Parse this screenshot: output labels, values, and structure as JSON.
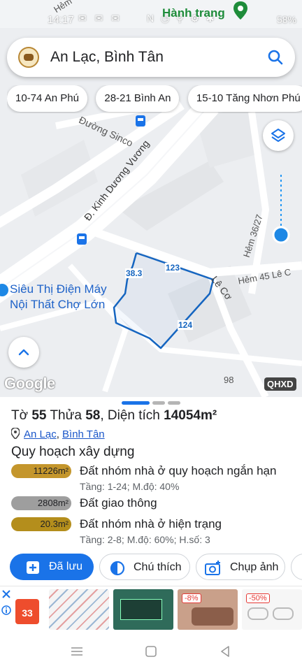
{
  "status_bar": {
    "time": "14:17",
    "left_icons": "✉ ✉ ✉",
    "right_icons": "N ◷ ⚲ ⚙ ✱",
    "network": "4G ᯤ",
    "battery": "58%"
  },
  "map": {
    "overlay_text": "Hành trang",
    "search": {
      "title": "An Lạc, Bình Tân"
    },
    "chips": [
      "10-74 An Phú",
      "28-21 Bình An",
      "15-10 Tăng Nhơn Phú"
    ],
    "labels": {
      "street_sinco": "Đường Sinco",
      "street_kdv": "Đ. Kinh Dương Vương",
      "lane_hem36": "Hẻm 36/27",
      "lane_hem45": "Hẻm 45 Lê C",
      "street_leco": "Lê Cơ",
      "poi_store_line1": "Siêu Thị Điện Máy",
      "poi_store_line2": "Nội Thất Chợ Lớn",
      "parcel_38": "38.3",
      "parcel_123": "123",
      "parcel_124": "124",
      "number_98": "98",
      "hem_top": "Hẻm"
    },
    "google": "Google",
    "qhxd": "QHXD"
  },
  "sheet": {
    "sheet_label": "Tờ",
    "sheet_no": "55",
    "parcel_label": "Thửa",
    "parcel_no": "58",
    "area_label": "Diện tích",
    "area": "14054m²",
    "ward": "An Lạc",
    "district": "Bình Tân",
    "section_title": "Quy hoạch xây dựng",
    "zones": [
      {
        "area": "11226m²",
        "name": "Đất nhóm nhà ở quy hoạch ngắn hạn",
        "detail": "Tầng: 1-24; M.độ: 40%",
        "color": "#c4962c"
      },
      {
        "area": "2808m²",
        "name": "Đất giao thông",
        "detail": "",
        "color": "#9e9e9e"
      },
      {
        "area": "20.3m²",
        "name": "Đất nhóm nhà ở hiện trạng",
        "detail": "Tầng: 2-8; M.độ: 60%; H.số: 3",
        "color": "#b48e1c"
      }
    ],
    "actions": {
      "saved": "Đã lưu",
      "legend": "Chú thích",
      "photo": "Chụp ảnh"
    }
  },
  "ad": {
    "shopee_badge": "33",
    "discount_1": "-8%",
    "discount_2": "-50%"
  },
  "colors": {
    "primary": "#1a73e8",
    "parcel_outline": "#1565c0",
    "route_dots": "#2196f3"
  }
}
